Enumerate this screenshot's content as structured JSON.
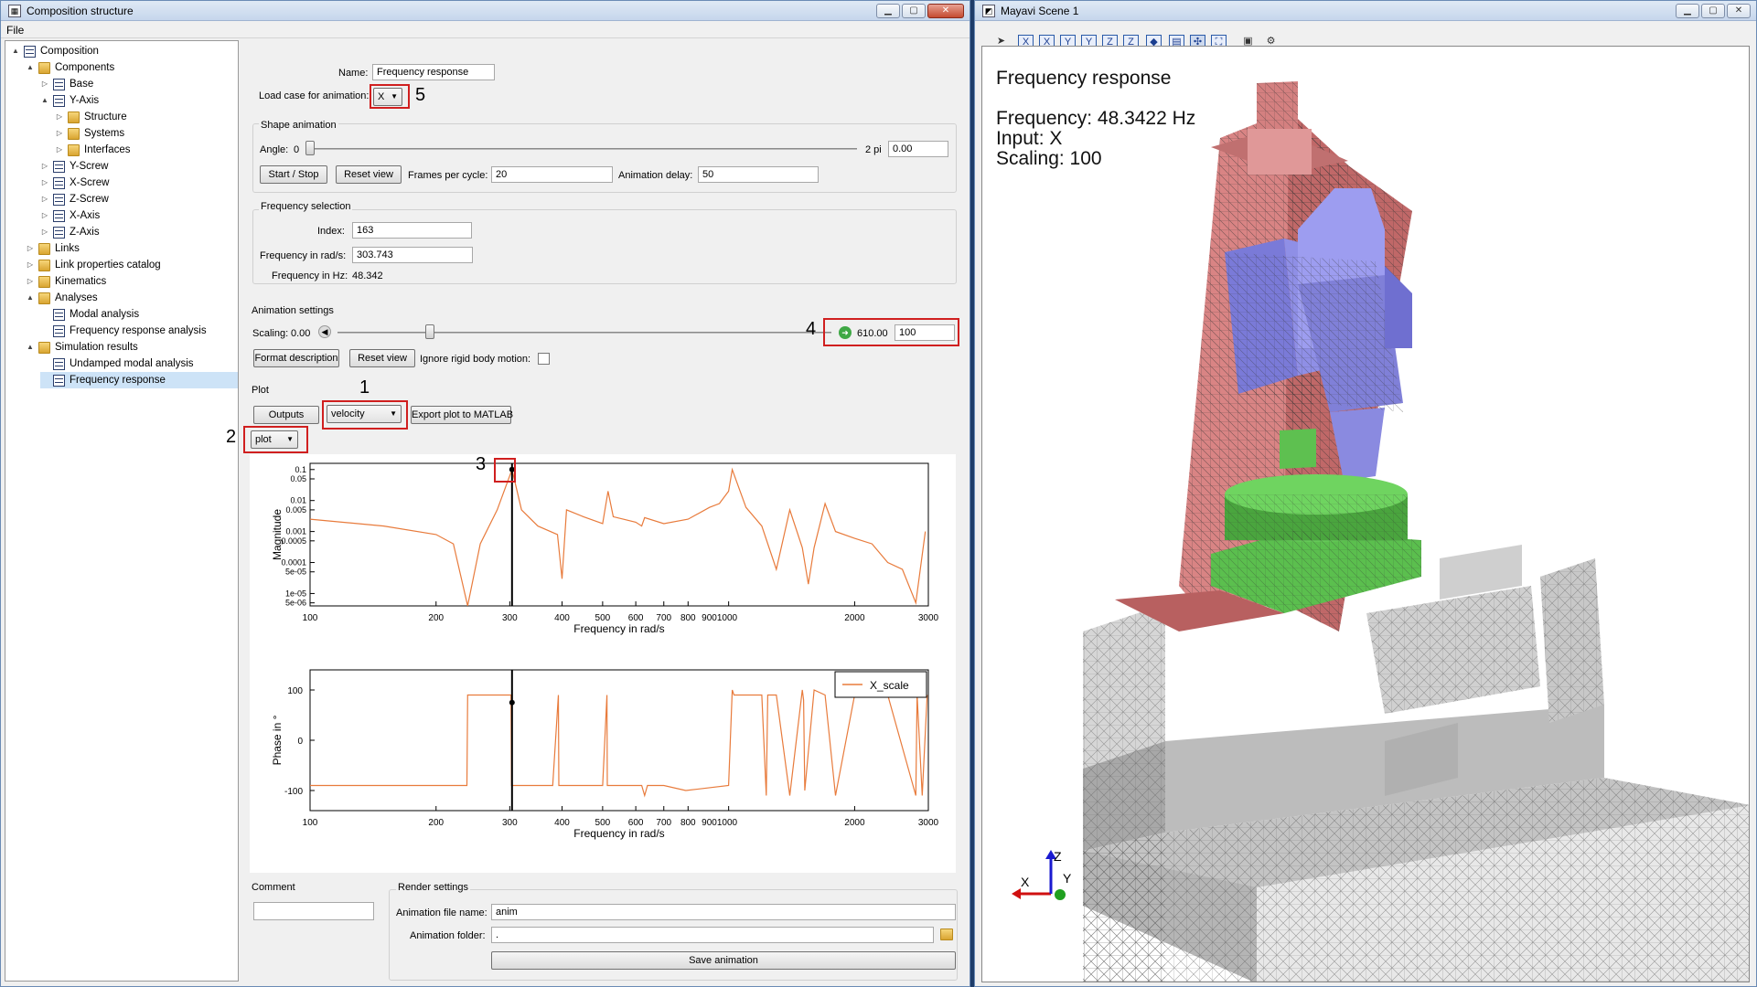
{
  "left_window": {
    "title": "Composition structure",
    "menu": "File"
  },
  "tree": [
    {
      "label": "Composition",
      "level": 0,
      "arrow": "▲",
      "icon": "comp"
    },
    {
      "label": "Components",
      "level": 1,
      "arrow": "▲",
      "icon": "folder"
    },
    {
      "label": "Base",
      "level": 2,
      "arrow": "▷",
      "icon": "comp"
    },
    {
      "label": "Y-Axis",
      "level": 2,
      "arrow": "▲",
      "icon": "comp"
    },
    {
      "label": "Structure",
      "level": 3,
      "arrow": "▷",
      "icon": "folder"
    },
    {
      "label": "Systems",
      "level": 3,
      "arrow": "▷",
      "icon": "folder"
    },
    {
      "label": "Interfaces",
      "level": 3,
      "arrow": "▷",
      "icon": "folder"
    },
    {
      "label": "Y-Screw",
      "level": 2,
      "arrow": "▷",
      "icon": "comp"
    },
    {
      "label": "X-Screw",
      "level": 2,
      "arrow": "▷",
      "icon": "comp"
    },
    {
      "label": "Z-Screw",
      "level": 2,
      "arrow": "▷",
      "icon": "comp"
    },
    {
      "label": "X-Axis",
      "level": 2,
      "arrow": "▷",
      "icon": "comp"
    },
    {
      "label": "Z-Axis",
      "level": 2,
      "arrow": "▷",
      "icon": "comp"
    },
    {
      "label": "Links",
      "level": 1,
      "arrow": "▷",
      "icon": "folder"
    },
    {
      "label": "Link properties catalog",
      "level": 1,
      "arrow": "▷",
      "icon": "folder"
    },
    {
      "label": "Kinematics",
      "level": 1,
      "arrow": "▷",
      "icon": "folder"
    },
    {
      "label": "Analyses",
      "level": 1,
      "arrow": "▲",
      "icon": "folder"
    },
    {
      "label": "Modal analysis",
      "level": 2,
      "arrow": "",
      "icon": "comp"
    },
    {
      "label": "Frequency response analysis",
      "level": 2,
      "arrow": "",
      "icon": "comp"
    },
    {
      "label": "Simulation results",
      "level": 1,
      "arrow": "▲",
      "icon": "folder"
    },
    {
      "label": "Undamped modal analysis",
      "level": 2,
      "arrow": "",
      "icon": "comp"
    },
    {
      "label": "Frequency response",
      "level": 2,
      "arrow": "",
      "icon": "comp",
      "selected": true
    }
  ],
  "form": {
    "name_label": "Name:",
    "name_value": "Frequency response",
    "loadcase_label": "Load case for animation:",
    "loadcase_value": "X",
    "shape_group": "Shape animation",
    "angle_label": "Angle:",
    "angle_min": "0",
    "angle_max": "2 pi",
    "angle_value": "0.00",
    "start_stop": "Start / Stop",
    "reset_view": "Reset view",
    "fpc_label": "Frames per cycle:",
    "fpc_value": "20",
    "delay_label": "Animation delay:",
    "delay_value": "50",
    "freq_group": "Frequency selection",
    "index_label": "Index:",
    "index_value": "163",
    "rad_label": "Frequency in rad/s:",
    "rad_value": "303.743",
    "hz_label": "Frequency in Hz:",
    "hz_value": "48.342",
    "anim_group": "Animation settings",
    "scaling_label": "Scaling:",
    "scaling_min": "0.00",
    "scaling_max": "610.00",
    "scaling_value": "100",
    "format_desc": "Format description",
    "reset_view2": "Reset view",
    "ignore_rigid": "Ignore rigid body motion:",
    "plot_group": "Plot",
    "outputs": "Outputs",
    "plot_quantity": "velocity",
    "export_matlab": "Export plot to MATLAB",
    "plot_type": "plot",
    "comment_label": "Comment",
    "render_group": "Render settings",
    "anim_file_label": "Animation file name:",
    "anim_file_value": "anim",
    "anim_folder_label": "Animation folder:",
    "anim_folder_value": ".",
    "save_animation": "Save animation"
  },
  "markers": [
    "1",
    "2",
    "3",
    "4",
    "5"
  ],
  "chart_data": [
    {
      "type": "line",
      "ylabel": "Magnitude",
      "xlabel": "Frequency in rad/s",
      "xscale": "log",
      "yscale": "log",
      "xlim": [
        100,
        3000
      ],
      "x_ticks": [
        "100",
        "200",
        "300",
        "400",
        "500",
        "600",
        "700",
        "800",
        "9001000",
        "2000",
        "3000"
      ],
      "y_ticks": [
        "0.1",
        "0.05",
        "0.01",
        "0.005",
        "0.001",
        "0.0005",
        "0.0001",
        "5e-05",
        "1e-05",
        "5e-06"
      ],
      "series": [
        {
          "color": "#e87b3c",
          "x": [
            100,
            150,
            200,
            220,
            238,
            255,
            280,
            303.7,
            320,
            350,
            390,
            400,
            410,
            450,
            500,
            515,
            530,
            560,
            600,
            620,
            630,
            700,
            800,
            900,
            950,
            1000,
            1020,
            1100,
            1200,
            1300,
            1400,
            1500,
            1550,
            1600,
            1700,
            1800,
            2000,
            2200,
            2400,
            2600,
            2800,
            2950
          ],
          "y": [
            0.0025,
            0.0015,
            0.0008,
            0.0004,
            4e-06,
            0.0004,
            0.005,
            0.1,
            0.005,
            0.0015,
            0.0008,
            3e-05,
            0.005,
            0.003,
            0.0018,
            0.02,
            0.003,
            0.0025,
            0.002,
            0.0015,
            0.0028,
            0.0018,
            0.0025,
            0.006,
            0.008,
            0.02,
            0.1,
            0.006,
            0.0015,
            6e-05,
            0.005,
            0.0003,
            2e-05,
            0.0003,
            0.008,
            0.001,
            0.0006,
            0.0004,
            0.0001,
            6e-05,
            5e-06,
            0.001
          ]
        }
      ],
      "cursor_x": 303.743
    },
    {
      "type": "line",
      "ylabel": "Phase in °",
      "xlabel": "Frequency in rad/s",
      "xscale": "log",
      "xlim": [
        100,
        3000
      ],
      "x_ticks": [
        "100",
        "200",
        "300",
        "400",
        "500",
        "600",
        "700",
        "800",
        "9001000",
        "2000",
        "3000"
      ],
      "y_ticks": [
        "100",
        "0",
        "-100"
      ],
      "series": [
        {
          "name": "X_scale",
          "color": "#e87b3c",
          "x": [
            100,
            237,
            238,
            302,
            303,
            380,
            392,
            393,
            500,
            512,
            513,
            620,
            630,
            640,
            700,
            790,
            1000,
            1020,
            1030,
            1100,
            1200,
            1230,
            1240,
            1300,
            1400,
            1500,
            1510,
            1520,
            1600,
            1700,
            1800,
            2000,
            2400,
            2800,
            2820,
            2900,
            2980
          ],
          "y": [
            -90,
            -90,
            90,
            90,
            -90,
            -90,
            90,
            -90,
            -90,
            90,
            -90,
            -90,
            -110,
            -90,
            -90,
            -100,
            -90,
            100,
            90,
            90,
            90,
            -110,
            90,
            90,
            -110,
            100,
            80,
            -100,
            100,
            90,
            -110,
            90,
            90,
            -110,
            90,
            -110,
            90
          ]
        }
      ],
      "cursor_x": 303.743,
      "cursor_y": 75
    }
  ],
  "right_window": {
    "title": "Mayavi Scene 1",
    "toolbar": [
      "arrow-icon",
      "x-minus-view-icon",
      "x-plus-view-icon",
      "y-minus-view-icon",
      "y-plus-view-icon",
      "z-minus-view-icon",
      "z-plus-view-icon",
      "iso-view-icon",
      "parallel-projection-icon",
      "axes-toggle-icon",
      "fullscreen-icon",
      "save-icon",
      "settings-icon"
    ],
    "overlay": {
      "title": "Frequency response",
      "frequency": "Frequency: 48.3422 Hz",
      "input": "Input: X",
      "scaling": "Scaling: 100"
    },
    "axes": {
      "x": "X",
      "y": "Y",
      "z": "Z"
    }
  }
}
